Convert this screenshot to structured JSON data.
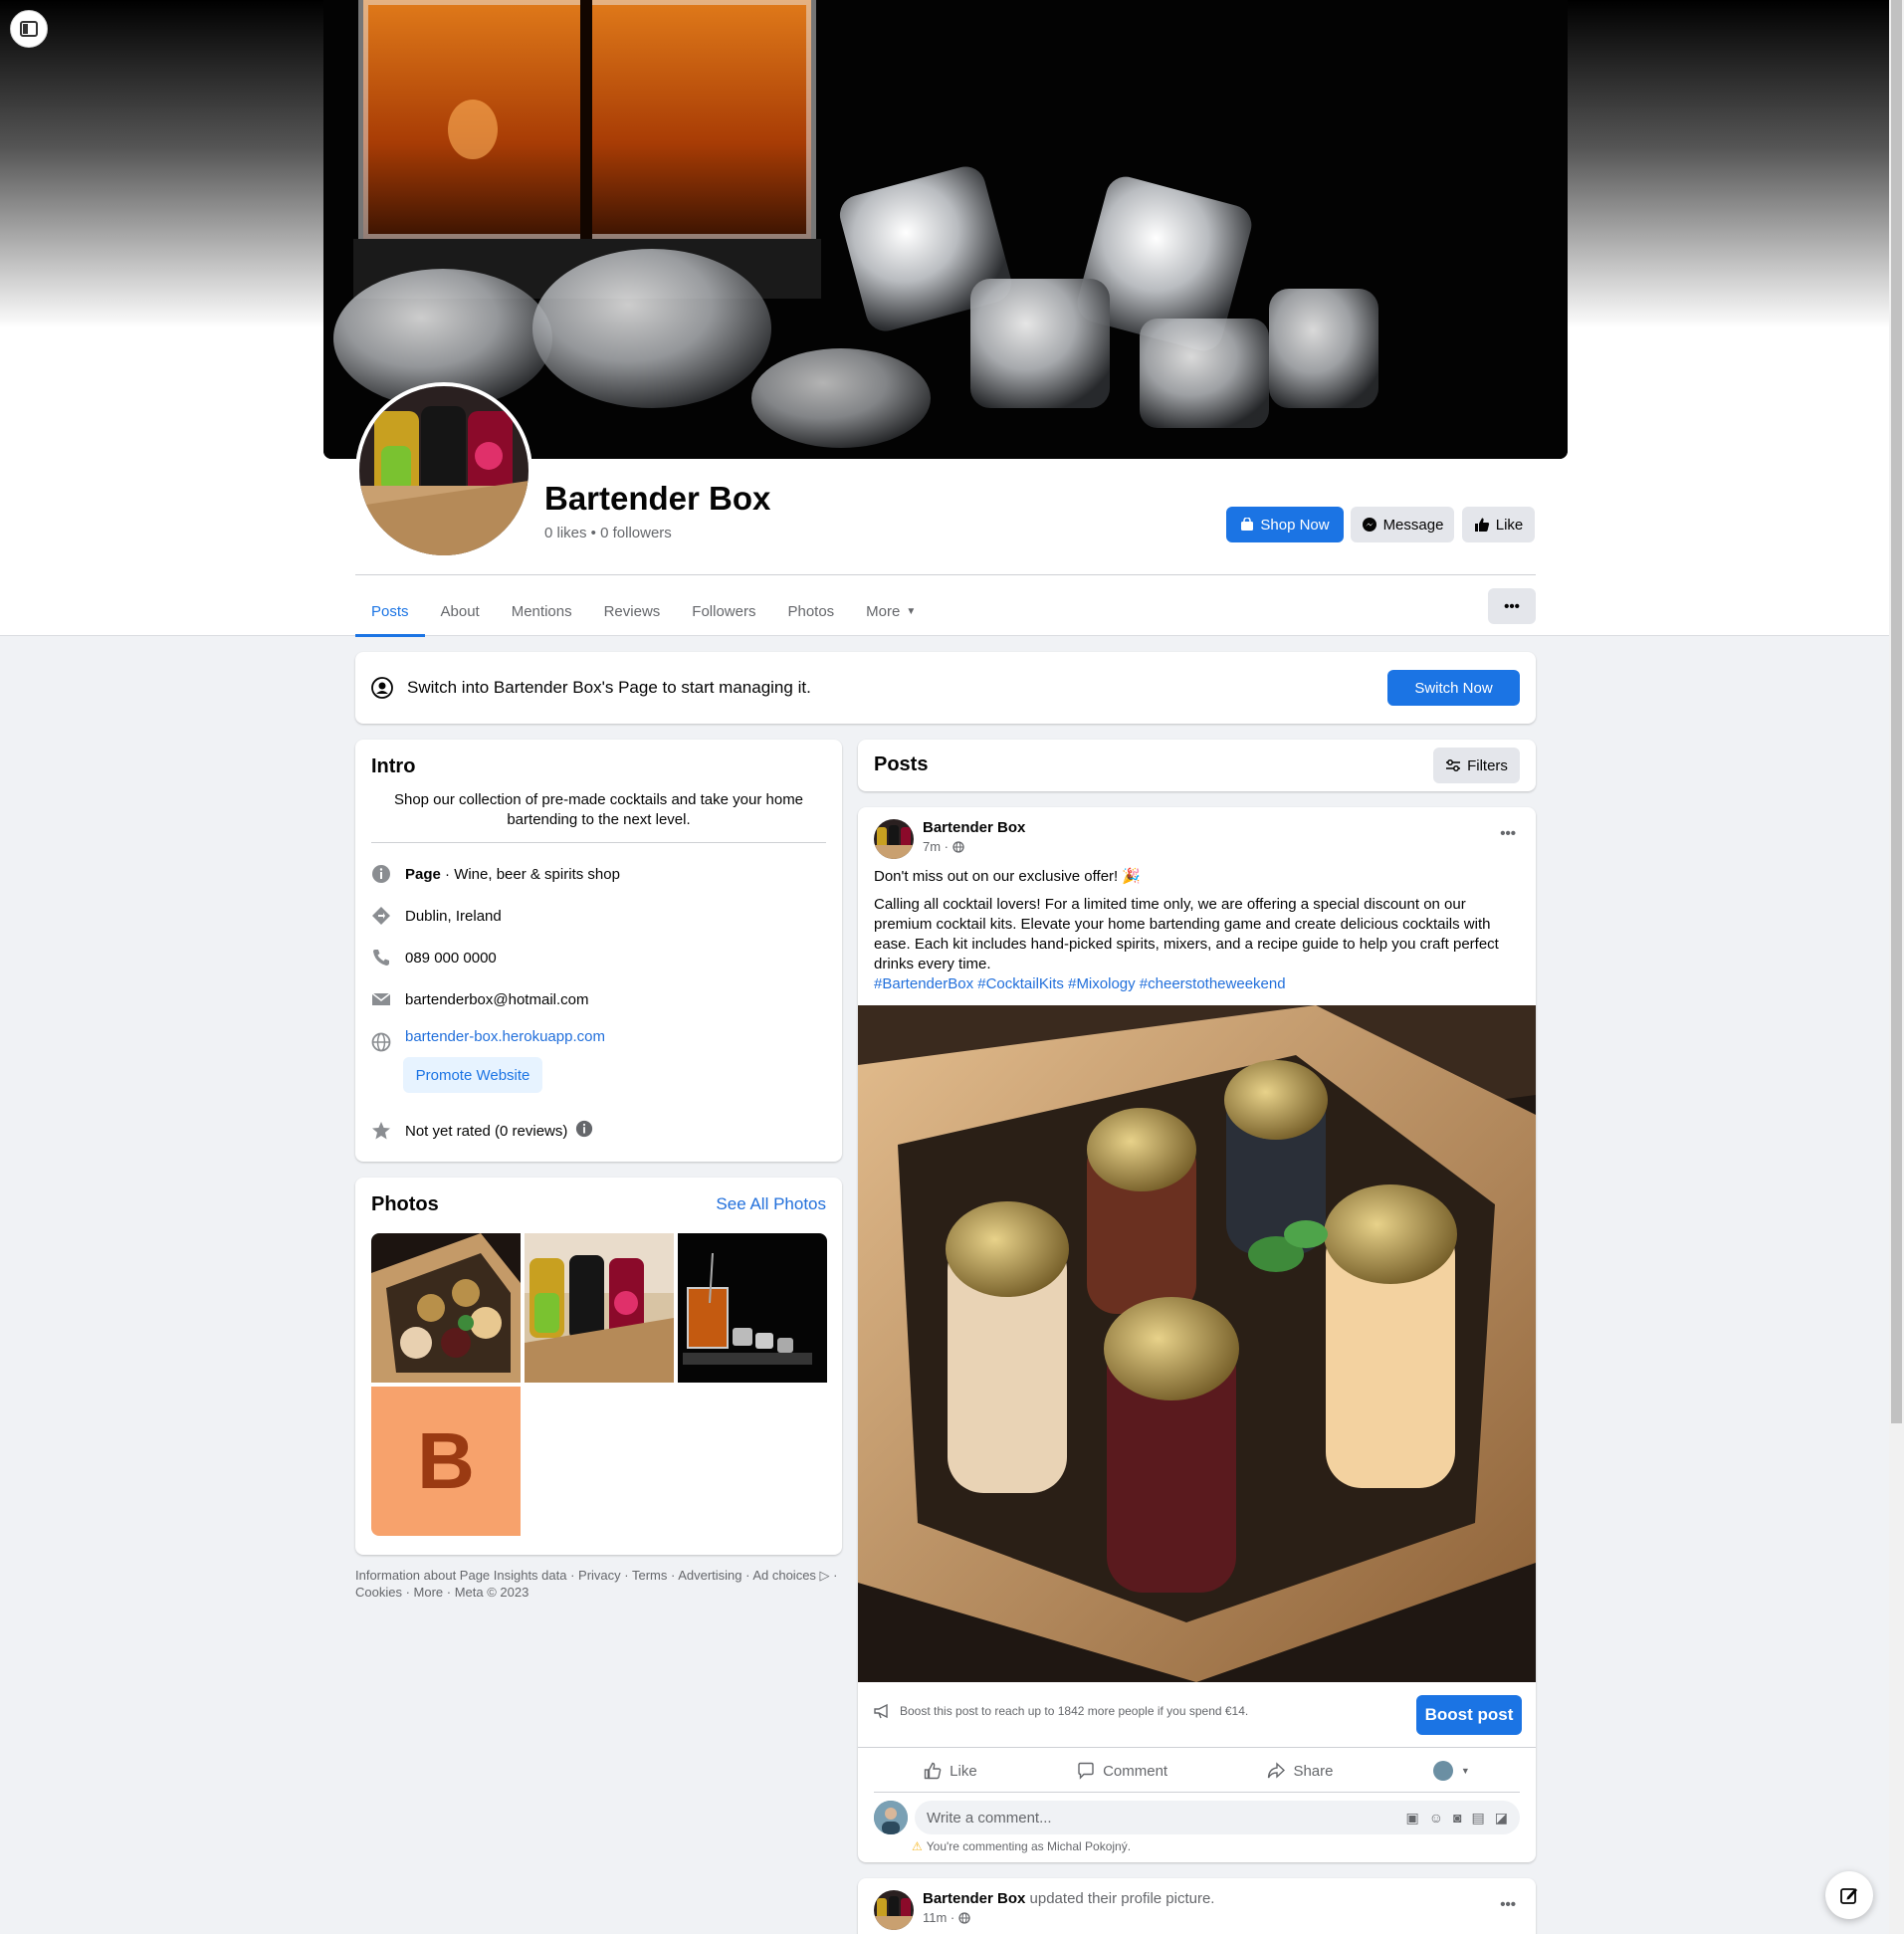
{
  "page": {
    "name": "Bartender Box",
    "stats": "0 likes • 0 followers"
  },
  "actions": {
    "shop_now": "Shop Now",
    "message": "Message",
    "like": "Like"
  },
  "tabs": [
    "Posts",
    "About",
    "Mentions",
    "Reviews",
    "Followers",
    "Photos",
    "More"
  ],
  "switch_banner": {
    "text": "Switch into Bartender Box's Page to start managing it.",
    "button": "Switch Now"
  },
  "intro": {
    "title": "Intro",
    "bio": "Shop our collection of pre-made cocktails and take your home bartending to the next level.",
    "category_label": "Page",
    "category": " · Wine, beer & spirits shop",
    "location": "Dublin, Ireland",
    "phone": "089 000 0000",
    "email": "bartenderbox@hotmail.com",
    "website": "bartender-box.herokuapp.com",
    "promote_button": "Promote Website",
    "rating": "Not yet rated (0 reviews)"
  },
  "photos": {
    "title": "Photos",
    "see_all": "See All Photos",
    "letter_tile": "B"
  },
  "footer": {
    "line1": "Information about Page Insights data · Privacy · Terms · Advertising · Ad choices ▷ ·",
    "line2": "Cookies · More · Meta © 2023"
  },
  "posts_header": {
    "title": "Posts",
    "filters": "Filters"
  },
  "post1": {
    "author": "Bartender Box",
    "time": "7m ·",
    "headline": "Don't miss out on our exclusive offer! 🎉",
    "body": "Calling all cocktail lovers! For a limited time only, we are offering a special discount on our premium cocktail kits. Elevate your home bartending game and create delicious cocktails with ease. Each kit includes hand-picked spirits, mixers, and a recipe guide to help you craft perfect drinks every time.",
    "hashtags": "#BartenderBox #CocktailKits #Mixology #cheerstotheweekend",
    "boost_text": "Boost this post to reach up to 1842 more people if you spend €14.",
    "boost_button": "Boost post",
    "like": "Like",
    "comment": "Comment",
    "share": "Share",
    "comment_placeholder": "Write a comment...",
    "commenting_as": "You're commenting as Michal Pokojný."
  },
  "post2": {
    "author": "Bartender Box",
    "action": " updated their profile picture.",
    "time": "11m ·"
  },
  "colors": {
    "accent": "#1b74e4",
    "background": "#f0f2f5"
  }
}
